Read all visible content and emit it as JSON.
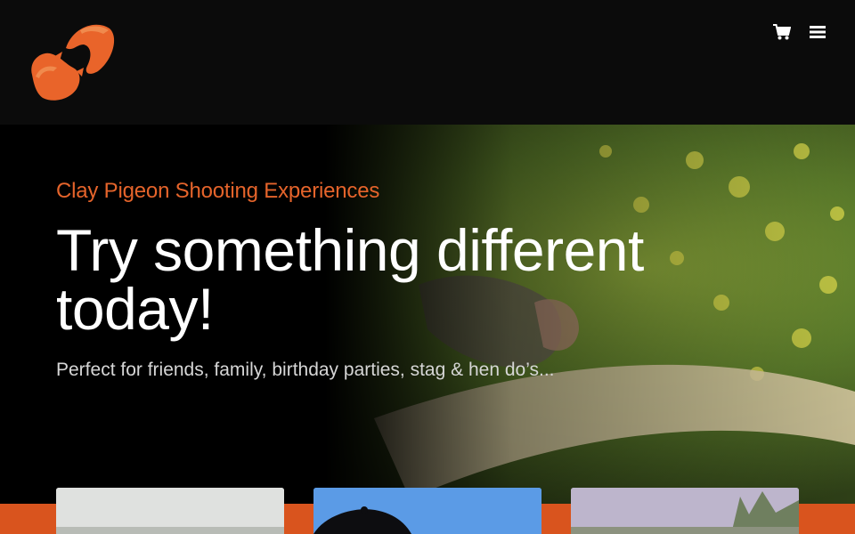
{
  "header": {
    "logo_name": "clay-pigeon-logo",
    "cart_icon": "cart-icon",
    "menu_icon": "hamburger-menu-icon"
  },
  "hero": {
    "eyebrow": "Clay Pigeon Shooting Experiences",
    "headline_line1": "Try something different",
    "headline_line2": "today!",
    "subtext": "Perfect for friends, family, birthday parties, stag & hen do’s..."
  },
  "colors": {
    "accent": "#e5642b",
    "band": "#d9541e",
    "header_bg": "#0b0b0b"
  },
  "cards": [
    {
      "image": "outdoor-field-photo"
    },
    {
      "image": "person-with-cap-sky-photo"
    },
    {
      "image": "trees-landscape-photo"
    }
  ]
}
